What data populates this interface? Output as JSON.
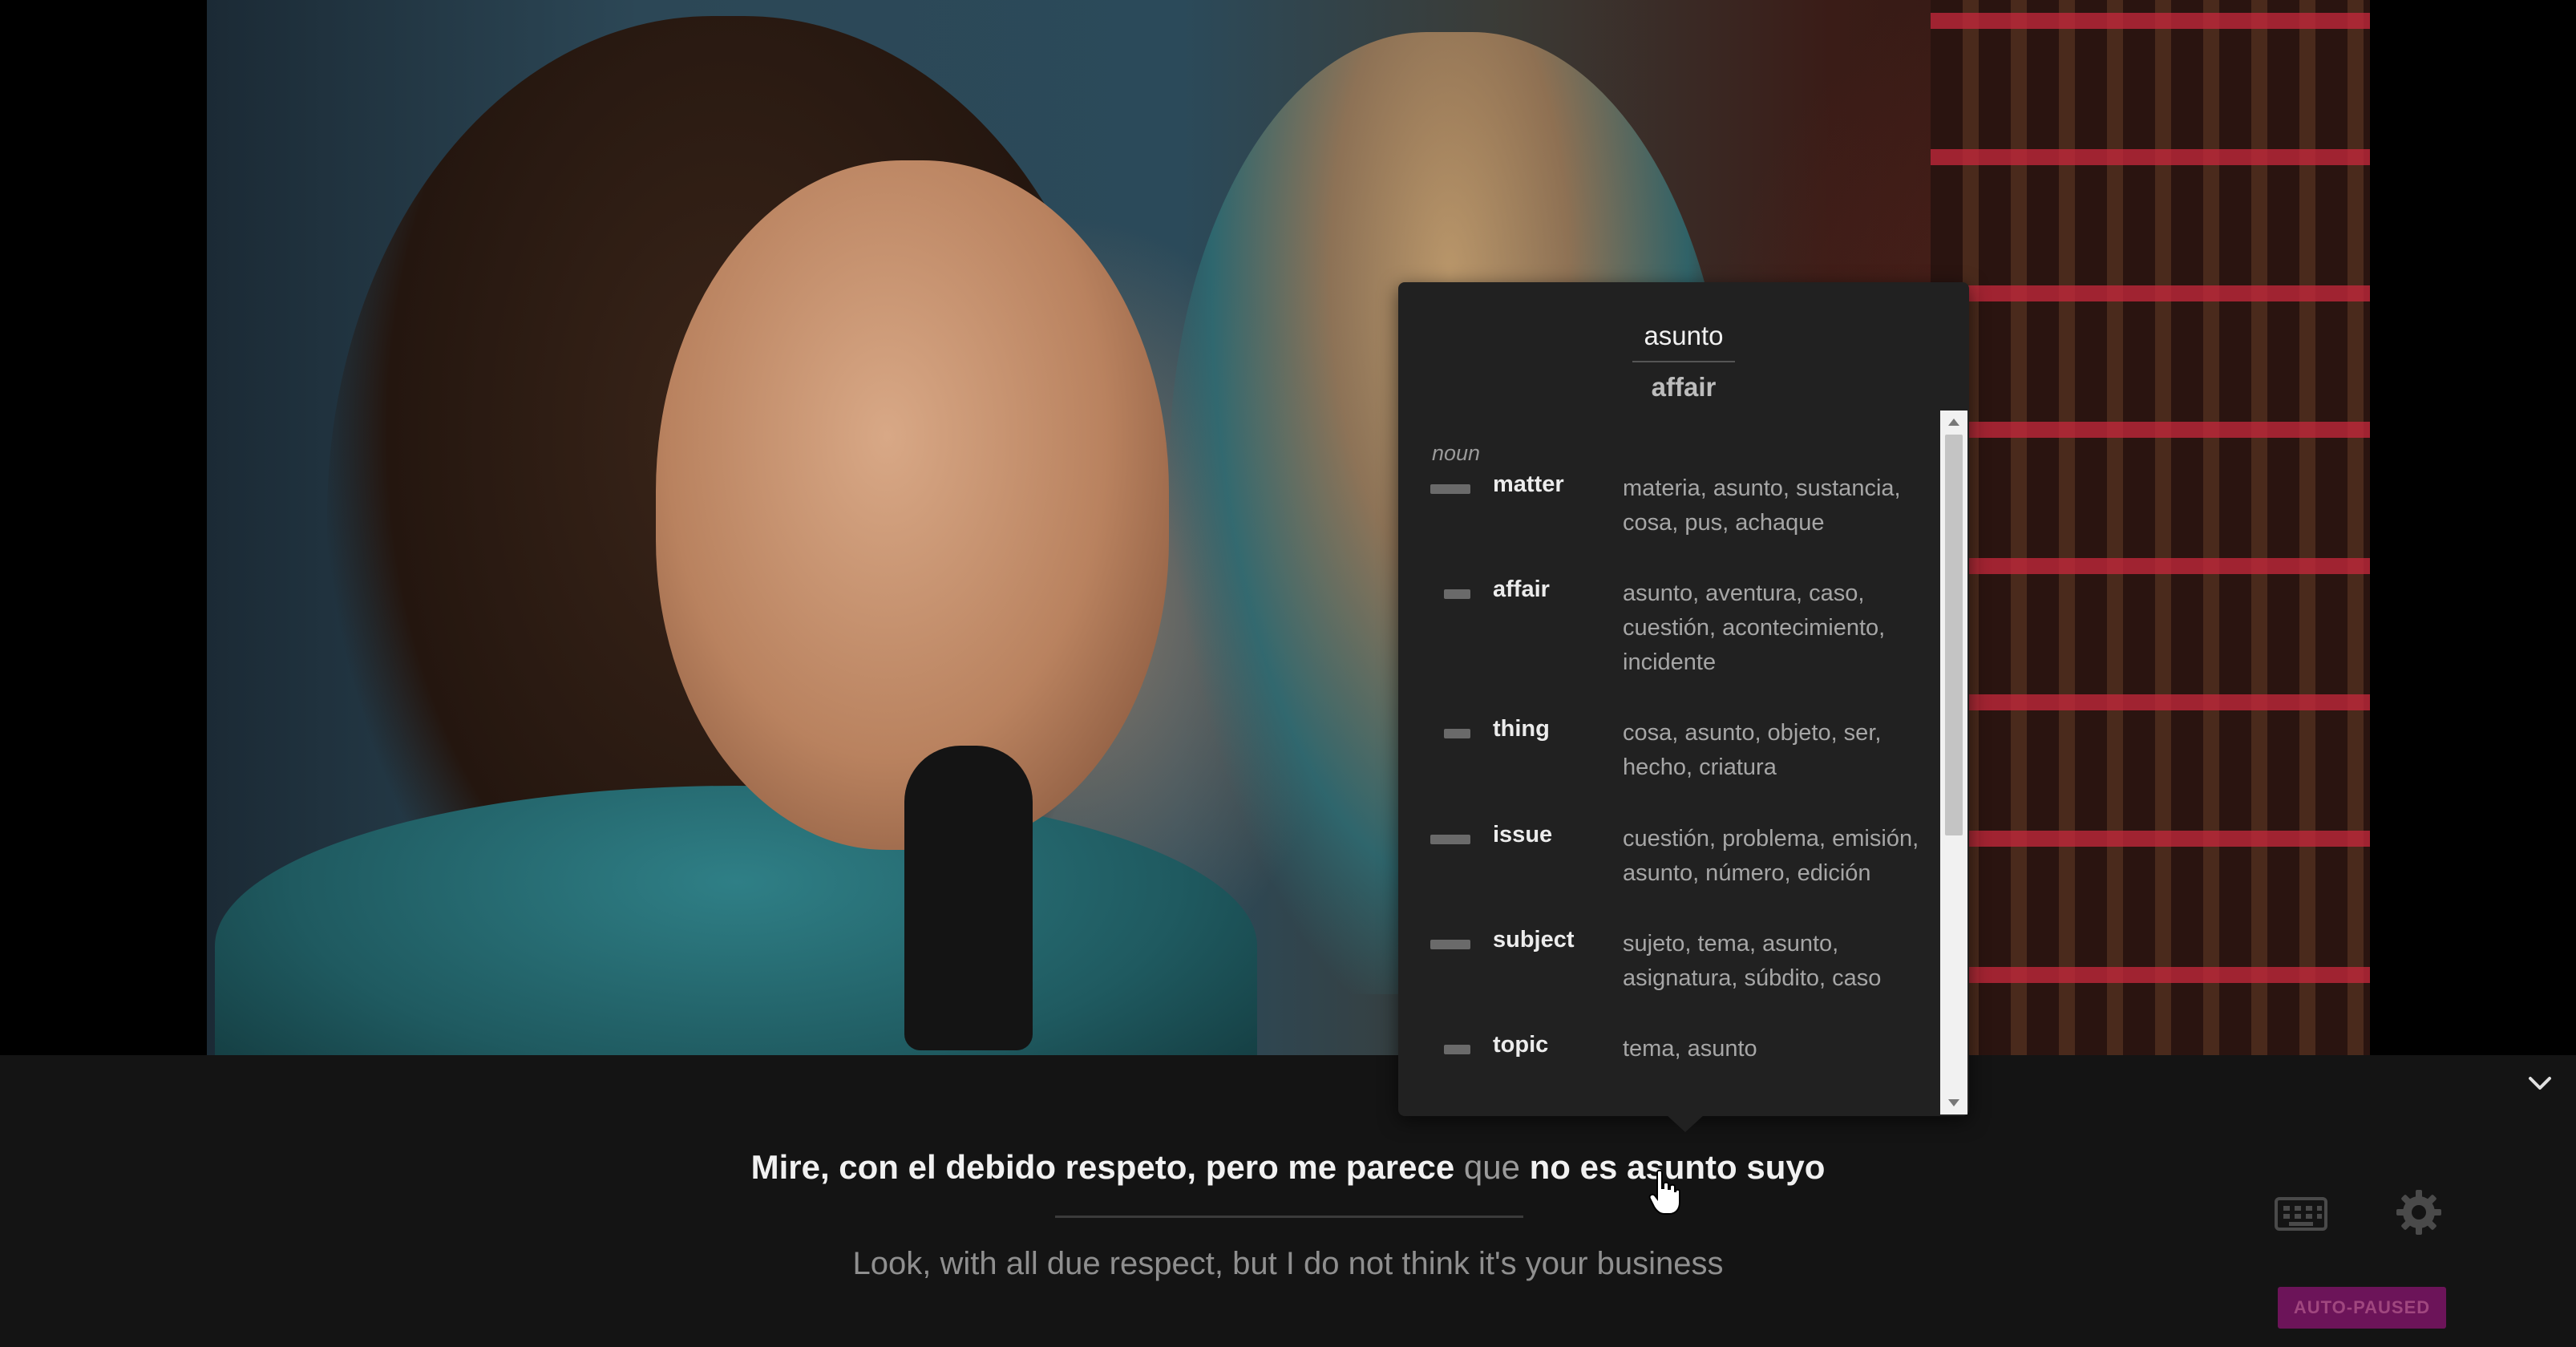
{
  "subtitles": {
    "original_words": [
      "Mire,",
      "con",
      "el",
      "debido",
      "respeto,",
      "pero",
      "me",
      "parece",
      "que",
      "no",
      "es",
      "asunto",
      "suyo"
    ],
    "highlighted_word": "que",
    "translation": "Look, with all due respect, but I do not think it's your business"
  },
  "popup": {
    "word": "asunto",
    "translation": "affair",
    "part_of_speech": "noun",
    "entries": [
      {
        "term": "matter",
        "synonyms": "materia, asunto, sustancia, cosa, pus, achaque",
        "frequency": 1.0
      },
      {
        "term": "affair",
        "synonyms": "asunto, aventura, caso, cuestión, acontecimiento, incidente",
        "frequency": 0.66
      },
      {
        "term": "thing",
        "synonyms": "cosa, asunto, objeto, ser, hecho, criatura",
        "frequency": 0.66
      },
      {
        "term": "issue",
        "synonyms": "cuestión, problema, emisión, asunto, número, edición",
        "frequency": 1.0
      },
      {
        "term": "subject",
        "synonyms": "sujeto, tema, asunto, asignatura, súbdito, caso",
        "frequency": 1.0
      },
      {
        "term": "topic",
        "synonyms": "tema, asunto",
        "frequency": 0.66
      }
    ]
  },
  "controls": {
    "auto_pause_label": "AUTO-PAUSED",
    "icons": [
      "chevron-down-icon",
      "keyboard-icon",
      "gear-icon",
      "hand-pointer-icon"
    ]
  },
  "colors": {
    "popup_bg": "#212121",
    "bar_bg": "#141414",
    "badge_bg": "#6c1459"
  }
}
